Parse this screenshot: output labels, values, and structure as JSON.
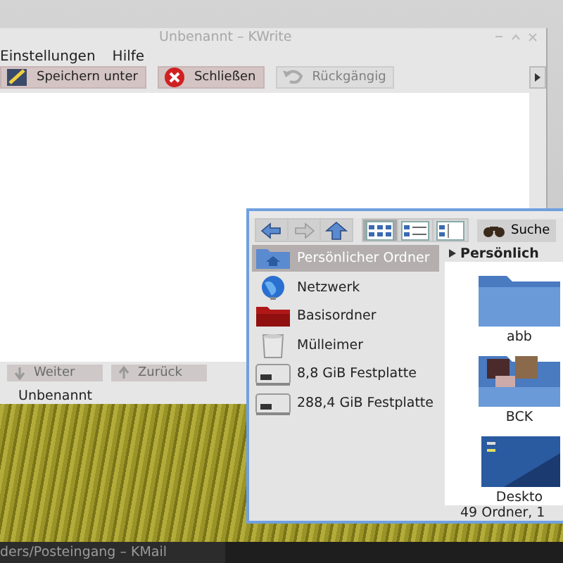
{
  "editor_window": {
    "title": "Unbenannt – KWrite",
    "menu": [
      {
        "label": "Einstellungen"
      },
      {
        "label": "Hilfe"
      }
    ],
    "toolbar": [
      {
        "label": "Speichern unter",
        "kind": "save",
        "disabled": false
      },
      {
        "label": "Schließen",
        "kind": "close",
        "disabled": false
      },
      {
        "label": "Rückgängig",
        "kind": "undo",
        "disabled": true
      }
    ],
    "find_bar": [
      {
        "label": "Weiter",
        "kind": "down",
        "disabled": true
      },
      {
        "label": "Zurück",
        "kind": "up",
        "disabled": true
      }
    ],
    "status": "Unbenannt"
  },
  "file_manager": {
    "nav_buttons": [
      {
        "kind": "back",
        "disabled": false
      },
      {
        "kind": "forward",
        "disabled": true
      },
      {
        "kind": "up",
        "disabled": false
      }
    ],
    "view_buttons": [
      {
        "kind": "icons",
        "selected": true
      },
      {
        "kind": "details",
        "selected": false
      },
      {
        "kind": "columns",
        "selected": false
      }
    ],
    "search_label": "Suche",
    "places": [
      {
        "label": "Persönlicher Ordner",
        "kind": "home",
        "selected": true
      },
      {
        "label": "Netzwerk",
        "kind": "network",
        "selected": false
      },
      {
        "label": "Basisordner",
        "kind": "root",
        "selected": false
      },
      {
        "label": "Mülleimer",
        "kind": "trash",
        "selected": false
      },
      {
        "label": "8,8 GiB Festplatte",
        "kind": "drive",
        "selected": false
      },
      {
        "label": "288,4 GiB Festplatte",
        "kind": "drive",
        "selected": false
      }
    ],
    "breadcrumb": "Persönlich",
    "items": [
      {
        "label": "abb",
        "kind": "folder"
      },
      {
        "label": "BCK",
        "kind": "photos"
      },
      {
        "label": "Deskto",
        "kind": "desktop"
      }
    ],
    "status": "49 Ordner, 1"
  },
  "taskbar": {
    "task": "ders/Posteingang – KMail"
  }
}
